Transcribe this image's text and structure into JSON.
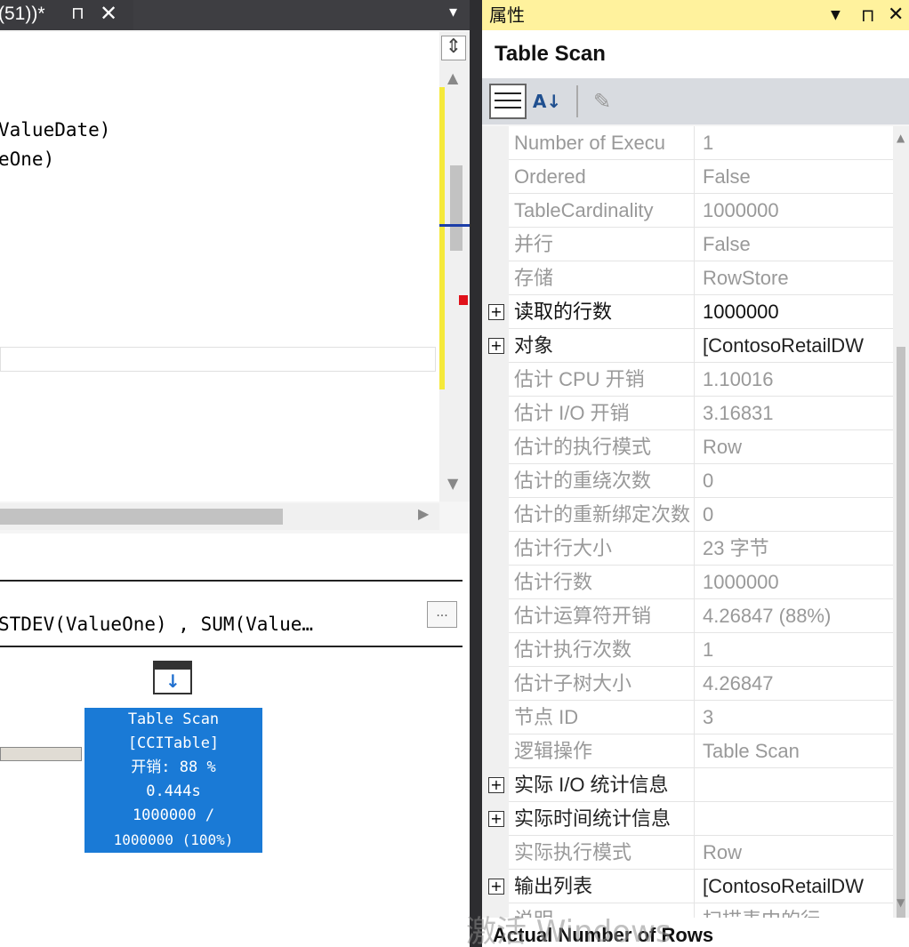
{
  "tab": {
    "title": "(51))*",
    "pin_glyph": "⊓",
    "close_glyph": "✕",
    "dropdown_glyph": "▾"
  },
  "editor": {
    "lines": [
      "ValueDate)",
      "eOne)"
    ],
    "split_glyph": "⇕"
  },
  "plan": {
    "query_text": "STDEV(ValueOne) , SUM(Value…",
    "ellipsis_label": "...",
    "operator": {
      "name": "Table Scan",
      "object": "[CCITable]",
      "cost": "开销: 88 %",
      "time": "0.444s",
      "rows": "1000000 /",
      "rows_pct": "1000000 (100%)"
    }
  },
  "properties": {
    "panel_title": "属性",
    "object_name": "Table Scan",
    "rows": [
      {
        "name": "Number of Execu",
        "value": "1",
        "style": "grey",
        "expand": false
      },
      {
        "name": "Ordered",
        "value": "False",
        "style": "grey",
        "expand": false
      },
      {
        "name": "TableCardinality",
        "value": "1000000",
        "style": "grey",
        "expand": false
      },
      {
        "name": "并行",
        "value": "False",
        "style": "grey",
        "expand": false
      },
      {
        "name": "存储",
        "value": "RowStore",
        "style": "grey",
        "expand": false
      },
      {
        "name": "读取的行数",
        "value": "1000000",
        "style": "bold",
        "expand": true
      },
      {
        "name": "对象",
        "value": "[ContosoRetailDW",
        "style": "dark",
        "expand": true
      },
      {
        "name": "估计 CPU 开销",
        "value": "1.10016",
        "style": "grey",
        "expand": false
      },
      {
        "name": "估计 I/O 开销",
        "value": "3.16831",
        "style": "grey",
        "expand": false
      },
      {
        "name": "估计的执行模式",
        "value": "Row",
        "style": "grey",
        "expand": false
      },
      {
        "name": "估计的重绕次数",
        "value": "0",
        "style": "grey",
        "expand": false
      },
      {
        "name": "估计的重新绑定次数",
        "value": "0",
        "style": "grey",
        "expand": false
      },
      {
        "name": "估计行大小",
        "value": "23 字节",
        "style": "grey",
        "expand": false
      },
      {
        "name": "估计行数",
        "value": "1000000",
        "style": "grey",
        "expand": false
      },
      {
        "name": "估计运算符开销",
        "value": "4.26847 (88%)",
        "style": "grey",
        "expand": false
      },
      {
        "name": "估计执行次数",
        "value": "1",
        "style": "grey",
        "expand": false
      },
      {
        "name": "估计子树大小",
        "value": "4.26847",
        "style": "grey",
        "expand": false
      },
      {
        "name": "节点 ID",
        "value": "3",
        "style": "grey",
        "expand": false
      },
      {
        "name": "逻辑操作",
        "value": "Table Scan",
        "style": "grey",
        "expand": false
      },
      {
        "name": "实际 I/O 统计信息",
        "value": "",
        "style": "dark",
        "expand": true
      },
      {
        "name": "实际时间统计信息",
        "value": "",
        "style": "dark",
        "expand": true
      },
      {
        "name": "实际执行模式",
        "value": "Row",
        "style": "grey",
        "expand": false
      },
      {
        "name": "输出列表",
        "value": "[ContosoRetailDW",
        "style": "dark",
        "expand": true
      },
      {
        "name": "说明",
        "value": "扫描表中的行",
        "style": "grey",
        "expand": false
      }
    ],
    "description_title": "Actual Number of Rows"
  },
  "watermark": "激活 Windows",
  "colors": {
    "title_bar_yellow": "#fff29d",
    "operator_blue": "#1a7ad6",
    "ide_dark": "#2d2d30"
  }
}
